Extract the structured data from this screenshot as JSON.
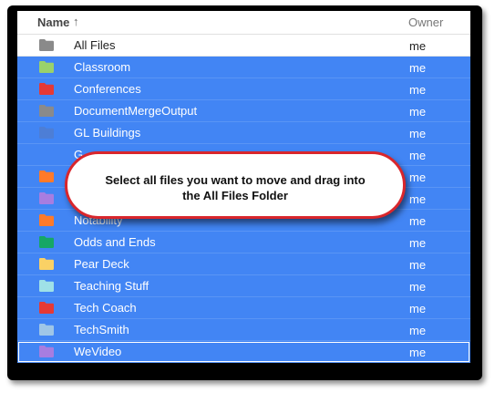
{
  "header": {
    "name_label": "Name",
    "sort_arrow": "↑",
    "owner_label": "Owner"
  },
  "rows": [
    {
      "name": "All Files",
      "owner": "me",
      "color": "#8a8a8a",
      "selected": false
    },
    {
      "name": "Classroom",
      "owner": "me",
      "color": "#9ad16b",
      "selected": true
    },
    {
      "name": "Conferences",
      "owner": "me",
      "color": "#e53935",
      "selected": true
    },
    {
      "name": "DocumentMergeOutput",
      "owner": "me",
      "color": "#8a8a8a",
      "selected": true
    },
    {
      "name": "GL Buildings",
      "owner": "me",
      "color": "#4d7ed6",
      "selected": true
    },
    {
      "name": "G",
      "owner": "me",
      "color": "#4285f4",
      "selected": true
    },
    {
      "name": "",
      "owner": "me",
      "color": "#ff7a29",
      "selected": true
    },
    {
      "name": "",
      "owner": "me",
      "color": "#a77de0",
      "selected": true
    },
    {
      "name": "Notability",
      "owner": "me",
      "color": "#ff7a29",
      "selected": true
    },
    {
      "name": "Odds and Ends",
      "owner": "me",
      "color": "#16a765",
      "selected": true
    },
    {
      "name": "Pear Deck",
      "owner": "me",
      "color": "#fad165",
      "selected": true
    },
    {
      "name": "Teaching Stuff",
      "owner": "me",
      "color": "#9fe1e7",
      "selected": true
    },
    {
      "name": "Tech Coach",
      "owner": "me",
      "color": "#e53935",
      "selected": true
    },
    {
      "name": "TechSmith",
      "owner": "me",
      "color": "#9fc6e7",
      "selected": true
    },
    {
      "name": "WeVideo",
      "owner": "me",
      "color": "#a77de0",
      "selected": true
    }
  ],
  "callout": {
    "line1": "Select all files you want to move and drag into",
    "line2": "the All Files Folder",
    "border_color": "#d9262c"
  },
  "colors": {
    "selection": "#4285f4"
  }
}
